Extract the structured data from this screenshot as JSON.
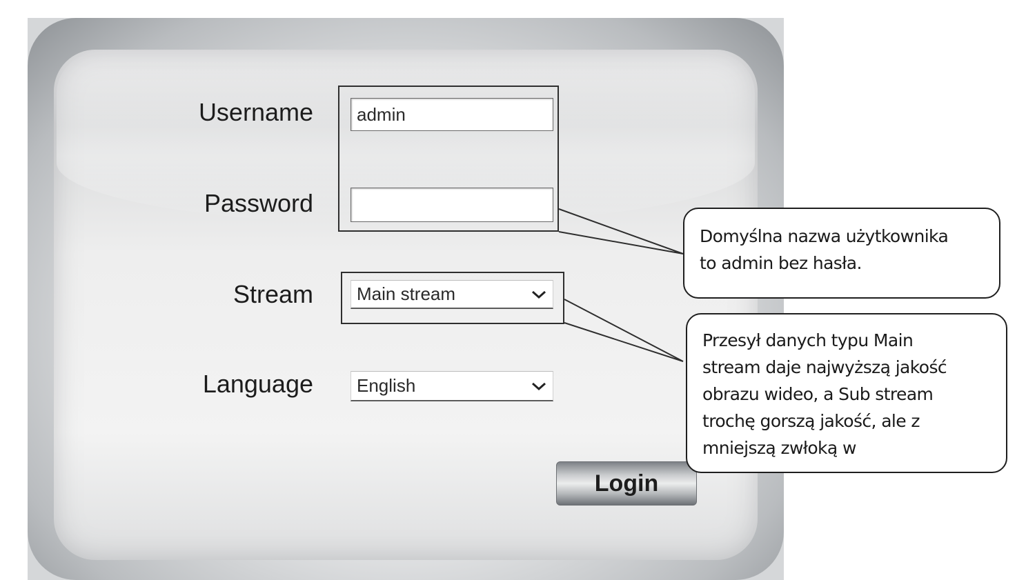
{
  "login_form": {
    "username_label": "Username",
    "username_value": "admin",
    "password_label": "Password",
    "password_value": "",
    "stream_label": "Stream",
    "stream_selected": "Main stream",
    "language_label": "Language",
    "language_selected": "English",
    "login_button": "Login"
  },
  "callouts": {
    "credentials_note": "Domyślna nazwa użytkownika\n to admin bez hasła.",
    "stream_note": "Przesył danych typu Main\nstream daje najwyższą jakość\nobrazu wideo, a Sub stream\ntrochę gorszą jakość, ale z\nmniejszą zwłoką w"
  },
  "icons": {
    "select_arrow": "chevron-down-icon"
  },
  "colors": {
    "panel_gray": "#8e9296",
    "frame_line": "#2e2e2e",
    "text": "#1c1c1c"
  }
}
